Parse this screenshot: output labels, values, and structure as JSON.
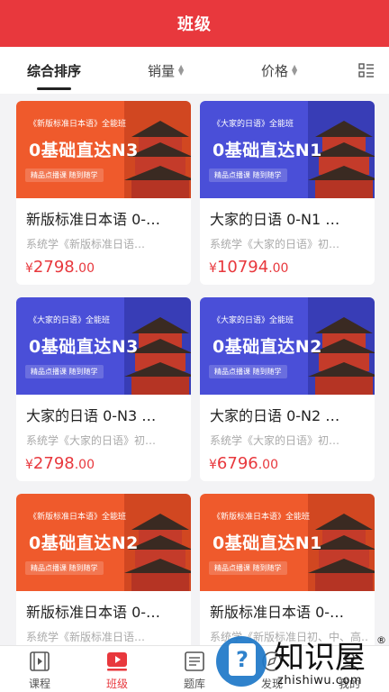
{
  "header": {
    "title": "班级"
  },
  "sortbar": {
    "items": [
      {
        "label": "综合排序"
      },
      {
        "label": "销量"
      },
      {
        "label": "价格"
      }
    ],
    "icons": {
      "sort": "sort-updown-icon",
      "layout": "list-layout-icon"
    }
  },
  "courses": [
    {
      "banner_tag": "《新版标准日本语》全能班",
      "banner_head": "0基础直达N3",
      "banner_pill": "精品点播课 随到随学",
      "title": "新版标准日本语 0-…",
      "subtitle": "系统学《新版标准日语…",
      "currency": "¥",
      "price_int": "2798",
      "price_dec": ".00",
      "theme": "orange",
      "color": "#ef5a2c"
    },
    {
      "banner_tag": "《大家的日语》全能班",
      "banner_head": "0基础直达N1",
      "banner_pill": "精品点播课 随到随学",
      "title": "大家的日语 0-N1 …",
      "subtitle": "系统学《大家的日语》初…",
      "currency": "¥",
      "price_int": "10794",
      "price_dec": ".00",
      "theme": "blue",
      "color": "#4a4fd8"
    },
    {
      "banner_tag": "《大家的日语》全能班",
      "banner_head": "0基础直达N3",
      "banner_pill": "精品点播课 随到随学",
      "title": "大家的日语 0-N3 …",
      "subtitle": "系统学《大家的日语》初…",
      "currency": "¥",
      "price_int": "2798",
      "price_dec": ".00",
      "theme": "blue",
      "color": "#4a4fd8"
    },
    {
      "banner_tag": "《大家的日语》全能班",
      "banner_head": "0基础直达N2",
      "banner_pill": "精品点播课 随到随学",
      "title": "大家的日语 0-N2 …",
      "subtitle": "系统学《大家的日语》初…",
      "currency": "¥",
      "price_int": "6796",
      "price_dec": ".00",
      "theme": "blue",
      "color": "#4a4fd8"
    },
    {
      "banner_tag": "《新版标准日本语》全能班",
      "banner_head": "0基础直达N2",
      "banner_pill": "精品点播课 随到随学",
      "title": "新版标准日本语 0-…",
      "subtitle": "系统学《新版标准日语…",
      "currency": "",
      "price_int": "",
      "price_dec": "",
      "theme": "orange",
      "color": "#ef5a2c"
    },
    {
      "banner_tag": "《新版标准日本语》全能班",
      "banner_head": "0基础直达N1",
      "banner_pill": "精品点播课 随到随学",
      "title": "新版标准日本语 0-…",
      "subtitle": "系统学《新版标准日初、中、高…",
      "currency": "",
      "price_int": "",
      "price_dec": "",
      "theme": "orange",
      "color": "#ef5a2c"
    }
  ],
  "tabbar": {
    "items": [
      {
        "label": "课程",
        "icon": "video-course-icon"
      },
      {
        "label": "班级",
        "icon": "class-play-icon"
      },
      {
        "label": "题库",
        "icon": "question-bank-icon"
      },
      {
        "label": "发现",
        "icon": "discover-icon"
      },
      {
        "label": "我的",
        "icon": "profile-icon"
      }
    ],
    "active_color": "#e8383d"
  },
  "watermark": {
    "cn": "知识屋",
    "en": "zhishiwu.com",
    "reg": "®"
  }
}
